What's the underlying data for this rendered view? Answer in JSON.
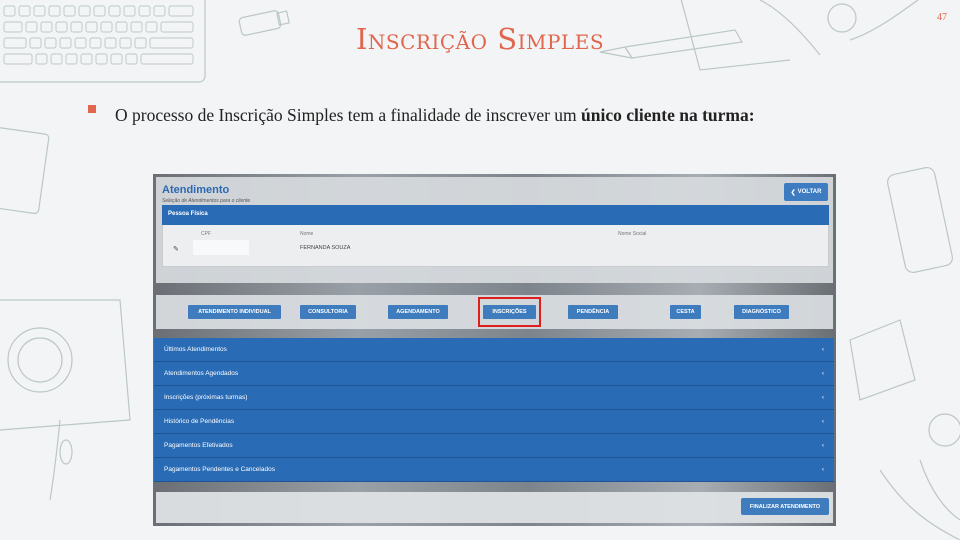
{
  "slide": {
    "number": "47",
    "title": "Inscrição Simples",
    "bullet": {
      "text_start": "O processo de Inscrição Simples tem a finalidade de inscrever um ",
      "text_bold": "único cliente na turma:"
    }
  },
  "colors": {
    "accent": "#e0664f",
    "app_blue": "#2a6bb5",
    "highlight": "#e01e1e"
  },
  "screenshot": {
    "header": {
      "title": "Atendimento",
      "subtitle": "Seleção de Atendimentos para o cliente",
      "back_label": "VOLTAR",
      "back_icon": "chevron-left-icon"
    },
    "pessoa_fisica": {
      "label": "Pessoa Física",
      "columns": [
        "CPF",
        "Nome",
        "Nome Social"
      ],
      "row": {
        "cpf": "",
        "nome": "FERNANDA SOUZA",
        "nome_social": ""
      },
      "edit_icon": "pencil-icon"
    },
    "tabs": [
      {
        "label": "ATENDIMENTO INDIVIDUAL"
      },
      {
        "label": "CONSULTORIA"
      },
      {
        "label": "AGENDAMENTO"
      },
      {
        "label": "INSCRIÇÕES",
        "highlighted": true
      },
      {
        "label": "PENDÊNCIA"
      },
      {
        "label": "CESTA"
      },
      {
        "label": "DIAGNÓSTICO"
      }
    ],
    "accordion": [
      {
        "label": "Últimos Atendimentos"
      },
      {
        "label": "Atendimentos Agendados"
      },
      {
        "label": "Inscrições (próximas turmas)"
      },
      {
        "label": "Histórico de Pendências"
      },
      {
        "label": "Pagamentos Efetivados"
      },
      {
        "label": "Pagamentos Pendentes e Cancelados"
      }
    ],
    "accordion_icon": "chevron-left-icon",
    "finish_label": "FINALIZAR ATENDIMENTO"
  }
}
